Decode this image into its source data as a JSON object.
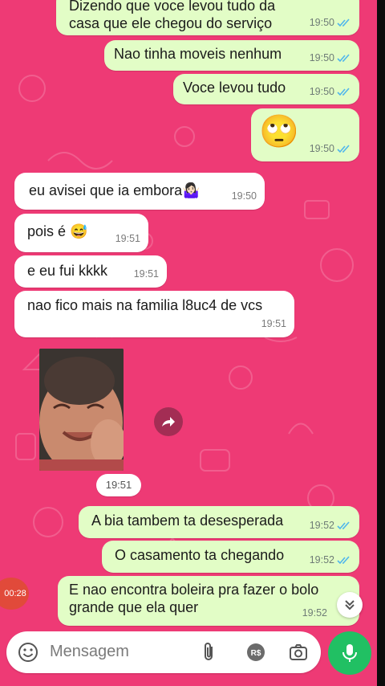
{
  "messages": [
    {
      "text": "Dizendo que voce levou tudo da casa que ele chegou do serviço",
      "time": "19:50",
      "dir": "out"
    },
    {
      "text": "Nao tinha moveis nenhum",
      "time": "19:50",
      "dir": "out"
    },
    {
      "text": "Voce levou tudo",
      "time": "19:50",
      "dir": "out"
    },
    {
      "text": "🙄",
      "time": "19:50",
      "dir": "out"
    },
    {
      "text": "eu avisei que ia embora🤷🏻‍♀️",
      "time": "19:50",
      "dir": "in"
    },
    {
      "text": "pois é 😅",
      "time": "19:51",
      "dir": "in"
    },
    {
      "text": "e eu fui kkkk",
      "time": "19:51",
      "dir": "in"
    },
    {
      "text": "nao fico mais na familia l8uc4 de vcs",
      "time": "19:51",
      "dir": "in"
    },
    {
      "text": "A bia tambem ta desesperada",
      "time": "19:52",
      "dir": "out"
    },
    {
      "text": "O casamento ta chegando",
      "time": "19:52",
      "dir": "out"
    },
    {
      "text": "E nao encontra boleira pra fazer o bolo grande que ela quer",
      "time": "19:52",
      "dir": "out"
    }
  ],
  "media": {
    "time": "19:51"
  },
  "composer": {
    "placeholder": "Mensagem"
  },
  "voice_timer": "00:28",
  "icons": [
    "emoji-icon",
    "attach-icon",
    "payment-icon",
    "camera-icon",
    "mic-icon",
    "forward-icon",
    "double-chevron-down-icon",
    "read-ticks-icon"
  ],
  "colors": {
    "wallpaper": "#ee3a75",
    "outgoing": "#e2fdc6",
    "incoming": "#ffffff",
    "ticks": "#4fb6ec",
    "send": "#21c063"
  }
}
